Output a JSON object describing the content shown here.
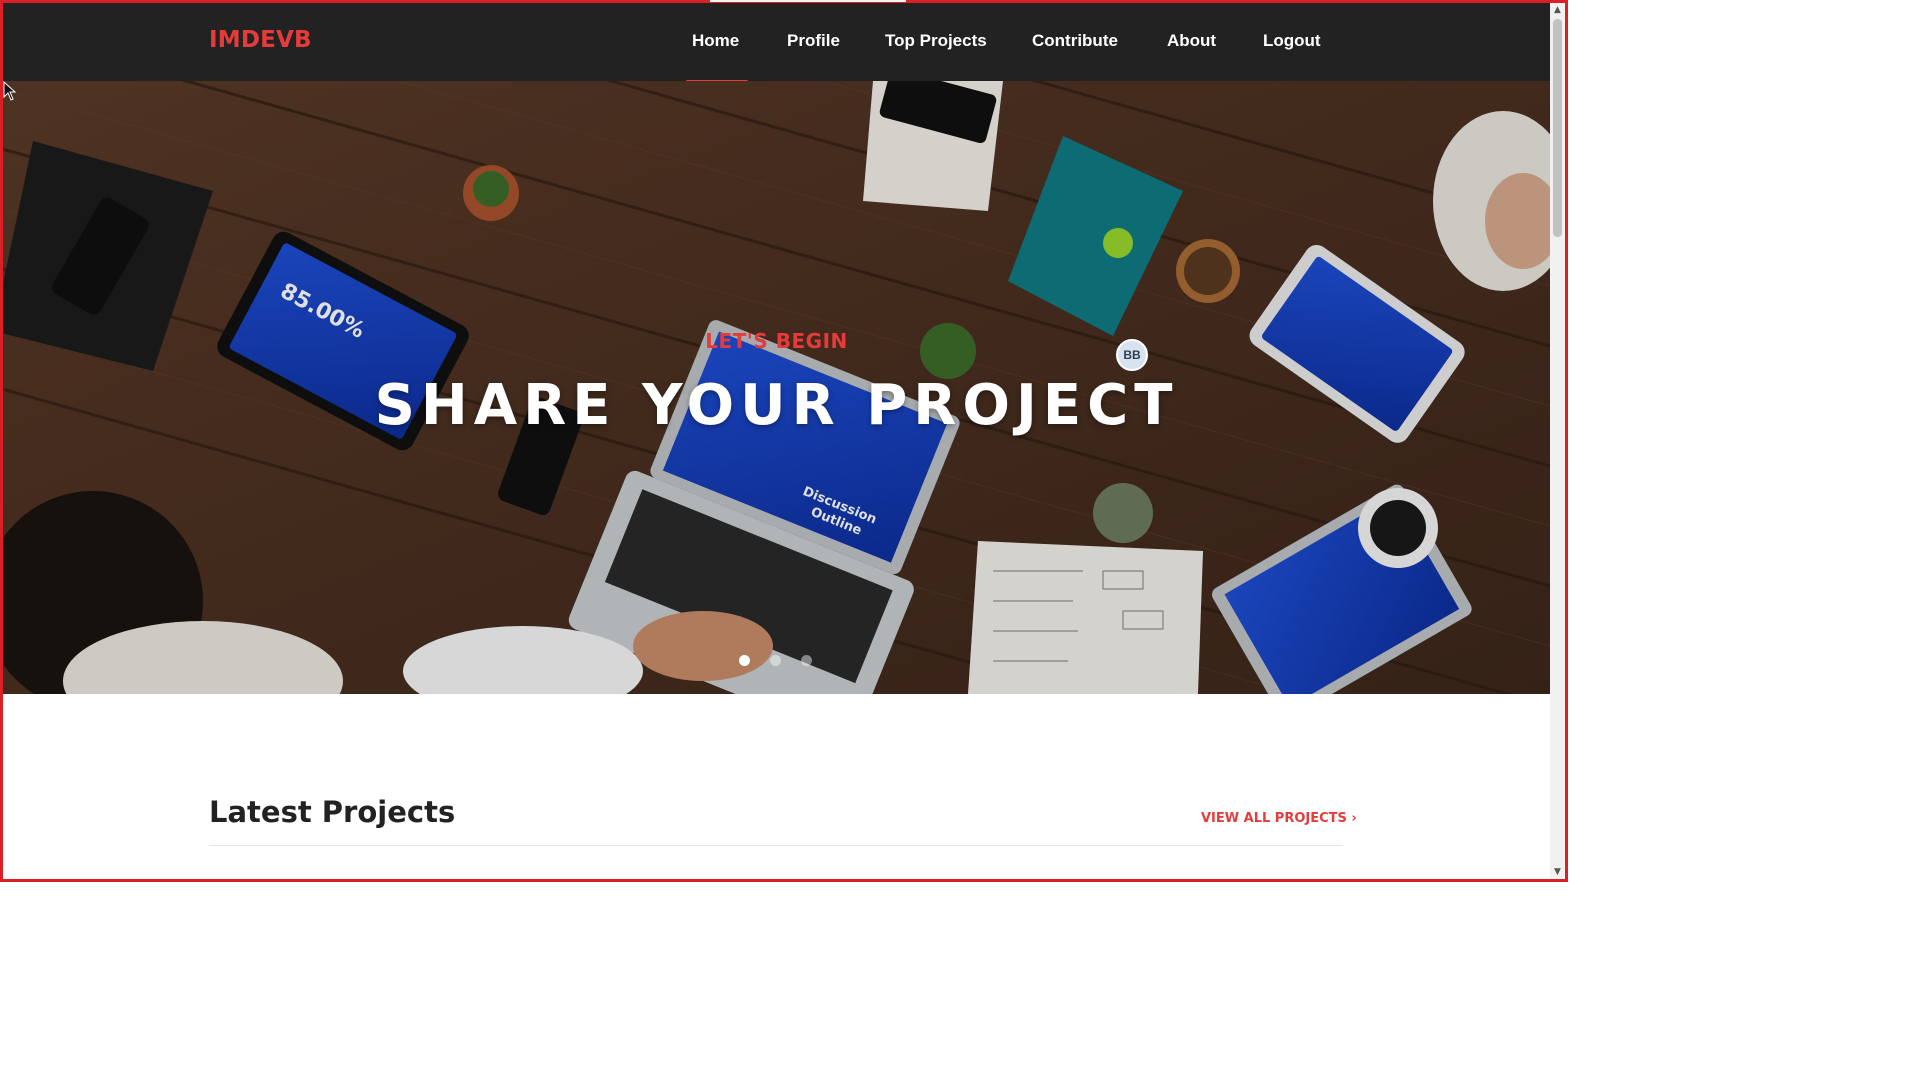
{
  "navbar": {
    "brand": "IMDEVB",
    "items": [
      {
        "label": "Home"
      },
      {
        "label": "Profile"
      },
      {
        "label": "Top Projects"
      },
      {
        "label": "Contribute"
      },
      {
        "label": "About"
      },
      {
        "label": "Logout"
      }
    ],
    "active": "Home"
  },
  "hero": {
    "subtitle": "LET'S BEGIN",
    "title": "SHARE YOUR PROJECT",
    "avatar_initials": "BB",
    "carousel": {
      "slides": 3,
      "active_index": 0
    }
  },
  "latest": {
    "title": "Latest Projects",
    "view_all": "VIEW ALL PROJECTS ›"
  },
  "colors": {
    "accent": "#e63b3b",
    "navbar_bg": "#222222",
    "page_bg": "#ffffff"
  },
  "icons": {
    "scroll_up": "chevron-up-icon",
    "scroll_down": "chevron-down-icon",
    "cursor": "mouse-pointer-icon"
  }
}
